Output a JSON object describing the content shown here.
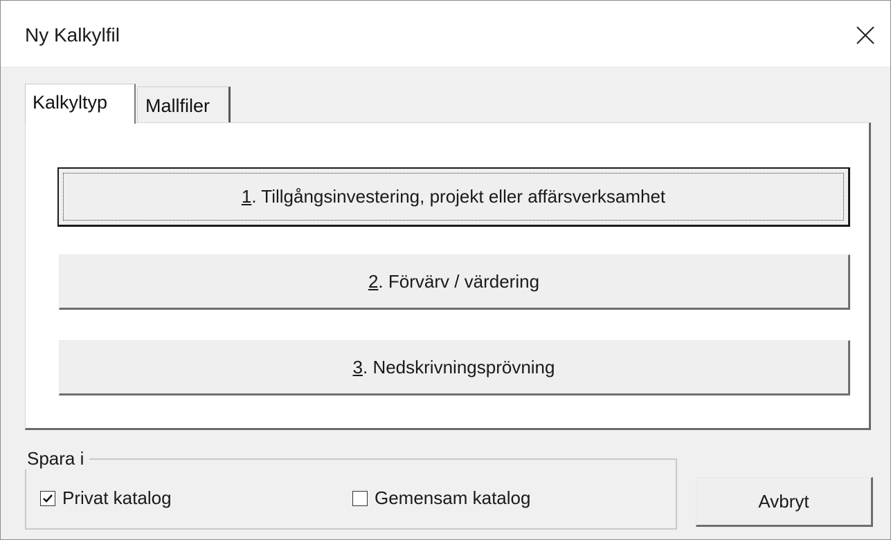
{
  "window": {
    "title": "Ny Kalkylfil",
    "close_icon": "close-icon"
  },
  "tabs": [
    {
      "label": "Kalkyltyp",
      "active": true
    },
    {
      "label": "Mallfiler",
      "active": false
    }
  ],
  "calc_types": [
    {
      "mnemonic": "1",
      "label": ". Tillgångsinvestering, projekt eller affärsverksamhet",
      "focused": true
    },
    {
      "mnemonic": "2",
      "label": ". Förvärv / värdering",
      "focused": false
    },
    {
      "mnemonic": "3",
      "label": ". Nedskrivningsprövning",
      "focused": false
    }
  ],
  "save_in": {
    "legend": "Spara i",
    "options": [
      {
        "label": "Privat katalog",
        "checked": true
      },
      {
        "label": "Gemensam katalog",
        "checked": false
      }
    ]
  },
  "cancel_label": "Avbryt"
}
